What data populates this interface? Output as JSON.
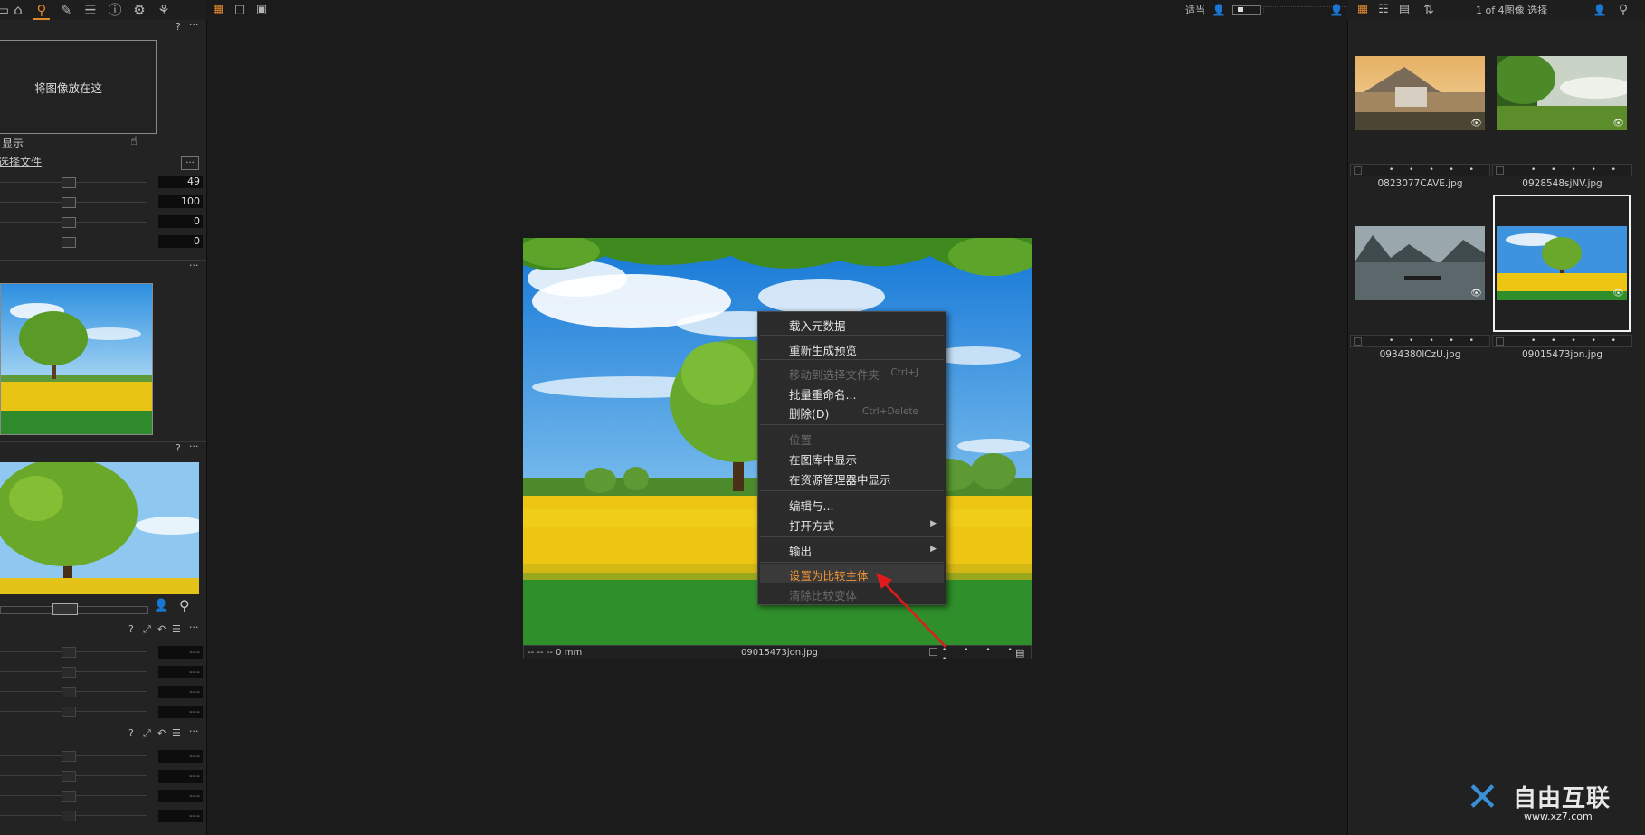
{
  "toolbar": {
    "left_tools": [
      "folder-icon",
      "capture-icon",
      "search-icon",
      "brush-icon",
      "list-icon",
      "info-icon",
      "settings-icon",
      "process-icon"
    ],
    "view_icons": [
      "grid-view-icon",
      "single-view-icon",
      "compare-view-icon"
    ],
    "fit_label": "适当",
    "browser_count": "1 of 4图像 选择"
  },
  "left_panel": {
    "drop_text": "将图像放在这",
    "show_label": "显示",
    "select_file_label": "选择文件",
    "ellipsis_label": "...",
    "slider_values": [
      "49",
      "100",
      "0",
      "0"
    ],
    "empty_value": "---",
    "help_label": "?",
    "menu_label": "···"
  },
  "viewer": {
    "focal_info": "-- -- -- 0 mm",
    "filename": "09015473jon.jpg"
  },
  "context_menu": {
    "items": [
      {
        "label": "载入元数据",
        "shortcut": "",
        "disabled": false
      },
      {
        "label": "重新生成预览",
        "shortcut": "",
        "disabled": false
      },
      {
        "label": "移动到选择文件夹",
        "shortcut": "Ctrl+J",
        "disabled": true
      },
      {
        "label": "批量重命名...",
        "shortcut": "",
        "disabled": false
      },
      {
        "label": "删除(D)",
        "shortcut": "Ctrl+Delete",
        "disabled": false
      },
      {
        "label": "位置",
        "shortcut": "",
        "disabled": true
      },
      {
        "label": "在图库中显示",
        "shortcut": "",
        "disabled": false
      },
      {
        "label": "在资源管理器中显示",
        "shortcut": "",
        "disabled": false
      },
      {
        "label": "编辑与...",
        "shortcut": "",
        "disabled": false
      },
      {
        "label": "打开方式",
        "shortcut": "",
        "disabled": false
      },
      {
        "label": "输出",
        "shortcut": "",
        "disabled": false
      },
      {
        "label": "设置为比较主体",
        "shortcut": "",
        "disabled": false
      },
      {
        "label": "清除比较变体",
        "shortcut": "",
        "disabled": true
      }
    ]
  },
  "browser": {
    "thumbnails": [
      {
        "name": "0823077CAVE.jpg"
      },
      {
        "name": "0928548sjNV.jpg"
      },
      {
        "name": "0934380lCzU.jpg"
      },
      {
        "name": "09015473jon.jpg",
        "selected": true
      }
    ],
    "rating_dots": "• • • • •"
  },
  "watermark": {
    "brand": "自由互联",
    "url": "www.xz7.com"
  },
  "colors": {
    "accent": "#e28a2b",
    "menu_highlight": "#f39433",
    "annotation_arrow": "#e01b1b"
  }
}
